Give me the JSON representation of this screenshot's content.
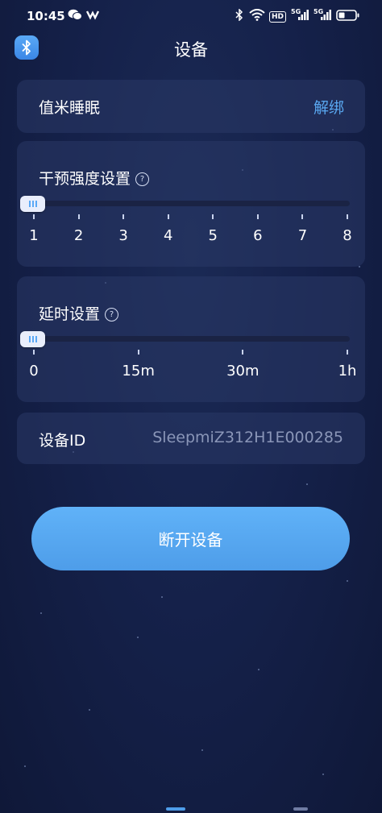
{
  "status_bar": {
    "time": "10:45",
    "left_icons": [
      "wechat-icon",
      "app-notification-icon"
    ],
    "right_icons": [
      "bluetooth-icon",
      "wifi-icon",
      "hd-icon",
      "signal-5g-icon",
      "signal-5g-icon",
      "battery-icon"
    ],
    "hd_label": "HD",
    "net_label_1": "5G",
    "net_label_2": "5G"
  },
  "header": {
    "title": "设备",
    "bluetooth_icon": "bluetooth-icon"
  },
  "device_card": {
    "name": "值米睡眠",
    "action": "解绑"
  },
  "intensity_card": {
    "label": "干预强度设置",
    "help_icon": "question-icon",
    "help_glyph": "?",
    "value": 1,
    "ticks": [
      "1",
      "2",
      "3",
      "4",
      "5",
      "6",
      "7",
      "8"
    ]
  },
  "delay_card": {
    "label": "延时设置",
    "help_icon": "question-icon",
    "help_glyph": "?",
    "value": "0",
    "ticks": [
      "0",
      "15m",
      "30m",
      "1h"
    ]
  },
  "device_id_card": {
    "label": "设备ID",
    "value": "SleepmiZ312H1E000285"
  },
  "disconnect_button": {
    "label": "断开设备"
  },
  "colors": {
    "accent": "#59a7f0",
    "background": "#15214a",
    "card": "#2a3966"
  }
}
